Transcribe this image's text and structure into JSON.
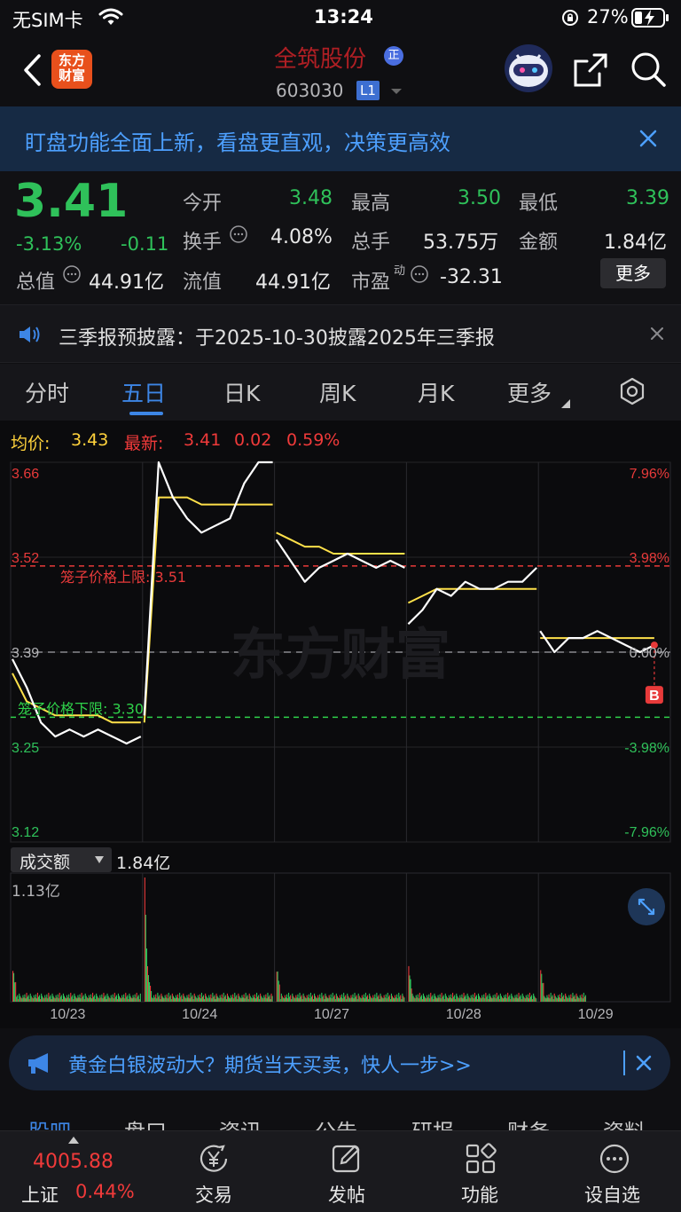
{
  "status_bar": {
    "carrier": "无SIM卡",
    "time": "13:24",
    "battery": "27%"
  },
  "nav": {
    "brand_line1": "东方",
    "brand_line2": "财富",
    "stock_name": "全筑股份",
    "name_badge": "正",
    "stock_code": "603030",
    "level_badge": "L1"
  },
  "banner": {
    "text": "盯盘功能全面上新，看盘更直观，决策更高效"
  },
  "quote": {
    "price": "3.41",
    "change_pct": "-3.13%",
    "change": "-0.11",
    "open_label": "今开",
    "open": "3.48",
    "high_label": "最高",
    "high": "3.50",
    "low_label": "最低",
    "low": "3.39",
    "turnover_label": "换手",
    "turnover": "4.08%",
    "volume_label": "总手",
    "volume": "53.75万",
    "amount_label": "金额",
    "amount": "1.84亿",
    "mktcap_label": "总值",
    "mktcap": "44.91亿",
    "float_label": "流值",
    "float_cap": "44.91亿",
    "pe_label": "市盈",
    "pe_sup": "动",
    "pe": "-32.31",
    "more_label": "更多"
  },
  "notice": {
    "text": "三季报预披露：于2025-10-30披露2025年三季报"
  },
  "tabs": [
    "分时",
    "五日",
    "日K",
    "周K",
    "月K",
    "更多"
  ],
  "active_tab": "五日",
  "chart_header": {
    "avg_label": "均价:",
    "avg": "3.43",
    "latest_label": "最新:",
    "latest": "3.41",
    "latest_change": "0.02",
    "latest_pct": "0.59%"
  },
  "chart_data": {
    "type": "line",
    "days": [
      "10/23",
      "10/24",
      "10/27",
      "10/28",
      "10/29"
    ],
    "y_ticks_left": [
      "3.66",
      "3.52",
      "3.39",
      "3.25",
      "3.12"
    ],
    "y_ticks_right": [
      "7.96%",
      "3.98%",
      "0.00%",
      "-3.98%",
      "-7.96%"
    ],
    "ylim": [
      3.12,
      3.66
    ],
    "prev_close": 3.39,
    "upper_limit_label": "笼子价格上限:",
    "upper_limit": "3.51",
    "lower_limit_label": "笼子价格下限:",
    "lower_limit": "3.30",
    "buy_marker": "B",
    "series": [
      {
        "name": "price",
        "color": "#ffffff",
        "values": [
          3.38,
          3.34,
          3.29,
          3.27,
          3.28,
          3.27,
          3.28,
          3.27,
          3.26,
          3.27,
          3.3,
          3.66,
          3.61,
          3.58,
          3.56,
          3.57,
          3.58,
          3.63,
          3.66,
          3.66,
          3.55,
          3.52,
          3.49,
          3.51,
          3.52,
          3.53,
          3.52,
          3.51,
          3.52,
          3.51,
          3.43,
          3.45,
          3.48,
          3.47,
          3.49,
          3.48,
          3.48,
          3.49,
          3.49,
          3.51,
          3.42,
          3.39,
          3.41,
          3.41,
          3.42,
          3.41,
          3.4,
          3.39,
          3.4,
          3.39
        ]
      },
      {
        "name": "avg",
        "color": "#ffe14a",
        "values": [
          3.36,
          3.32,
          3.31,
          3.3,
          3.3,
          3.3,
          3.3,
          3.29,
          3.29,
          3.29,
          3.29,
          3.61,
          3.61,
          3.61,
          3.6,
          3.6,
          3.6,
          3.6,
          3.6,
          3.6,
          3.56,
          3.55,
          3.54,
          3.54,
          3.53,
          3.53,
          3.53,
          3.53,
          3.53,
          3.53,
          3.46,
          3.47,
          3.48,
          3.48,
          3.48,
          3.48,
          3.48,
          3.48,
          3.48,
          3.48,
          3.41,
          3.41,
          3.41,
          3.41,
          3.41,
          3.41,
          3.41,
          3.41,
          3.41,
          3.41
        ]
      }
    ],
    "volume_label": "成交额",
    "volume_total": "1.84亿",
    "volume_max": "1.13亿"
  },
  "promo": {
    "text": "黄金白银波动大？期货当天买卖，快人一步>>"
  },
  "sub_tabs": [
    "股吧",
    "盘口",
    "资讯",
    "公告",
    "研报",
    "财务",
    "资料"
  ],
  "bottom_bar": {
    "index_value": "4005.88",
    "index_name": "上证",
    "index_pct": "0.44%",
    "items": [
      {
        "label": "交易",
        "icon": "yen-icon"
      },
      {
        "label": "发帖",
        "icon": "edit-icon"
      },
      {
        "label": "功能",
        "icon": "grid-icon"
      },
      {
        "label": "设自选",
        "icon": "more-icon"
      }
    ]
  },
  "colors": {
    "up": "#f03a3a",
    "down": "#2fc15a",
    "accent": "#3d86e6",
    "background": "#0f0f12"
  }
}
